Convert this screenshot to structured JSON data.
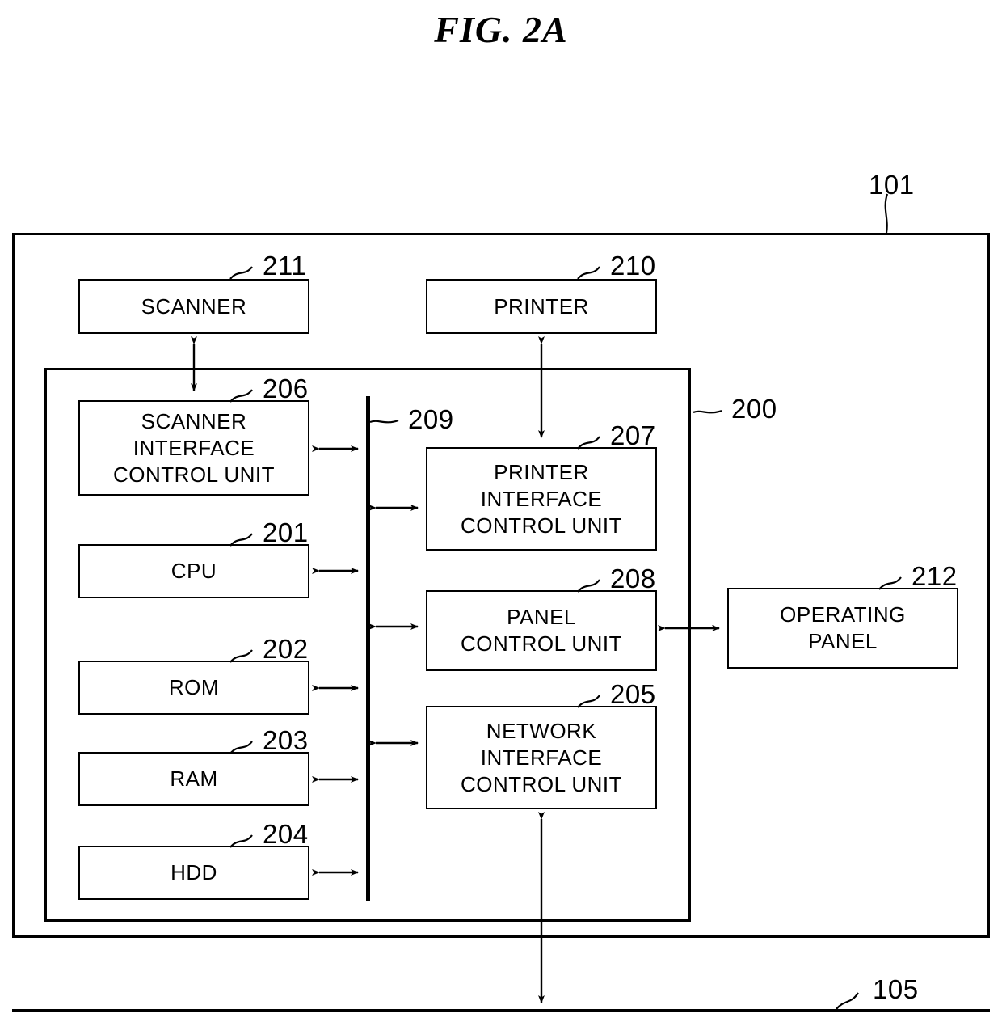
{
  "figure": {
    "title": "FIG. 2A"
  },
  "blocks": [
    {
      "id": "scanner",
      "label": "SCANNER",
      "ref": "211"
    },
    {
      "id": "printer",
      "label": "PRINTER",
      "ref": "210"
    },
    {
      "id": "scanner_if",
      "label": "SCANNER\nINTERFACE\nCONTROL UNIT",
      "ref": "206"
    },
    {
      "id": "cpu",
      "label": "CPU",
      "ref": "201"
    },
    {
      "id": "rom",
      "label": "ROM",
      "ref": "202"
    },
    {
      "id": "ram",
      "label": "RAM",
      "ref": "203"
    },
    {
      "id": "hdd",
      "label": "HDD",
      "ref": "204"
    },
    {
      "id": "printer_if",
      "label": "PRINTER\nINTERFACE\nCONTROL UNIT",
      "ref": "207"
    },
    {
      "id": "panel_ctrl",
      "label": "PANEL\nCONTROL UNIT",
      "ref": "208"
    },
    {
      "id": "network_if",
      "label": "NETWORK\nINTERFACE\nCONTROL UNIT",
      "ref": "205"
    },
    {
      "id": "operating_panel",
      "label": "OPERATING\nPANEL",
      "ref": "212"
    }
  ],
  "refs": {
    "device": "101",
    "controller": "200",
    "bus": "209",
    "network": "105"
  },
  "colors": {
    "line": "#000000",
    "background": "#ffffff"
  }
}
